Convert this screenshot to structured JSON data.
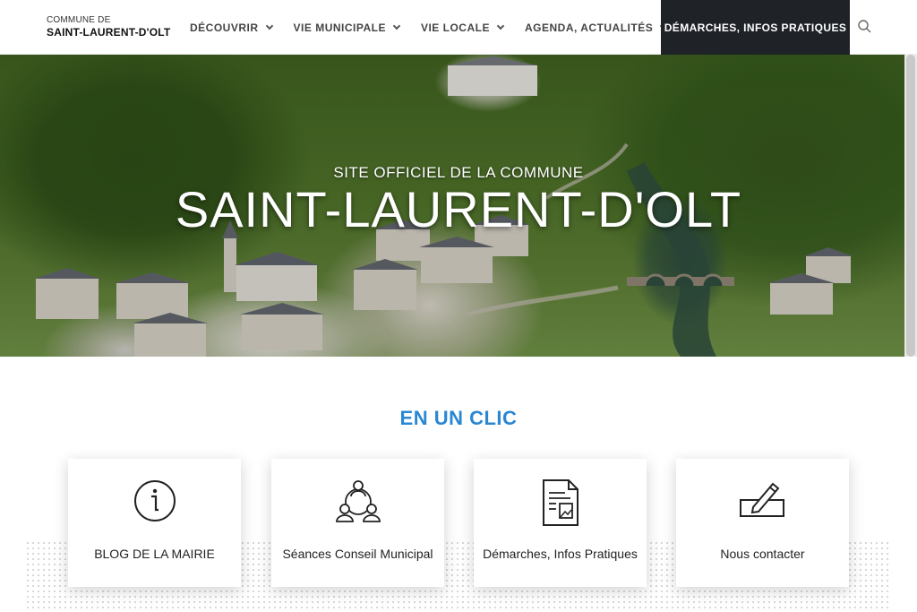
{
  "header": {
    "logo_small": "COMMUNE DE",
    "logo_big": "SAINT-LAURENT-D'OLT",
    "nav": [
      {
        "label": "DÉCOUVRIR"
      },
      {
        "label": "VIE MUNICIPALE"
      },
      {
        "label": "VIE LOCALE"
      },
      {
        "label": "AGENDA, ACTUALITÉS"
      }
    ],
    "cta_label": "DÉMARCHES, INFOS PRATIQUES",
    "search_icon": "search-icon"
  },
  "hero": {
    "subtitle": "SITE OFFICIEL DE LA COMMUNE",
    "title": "SAINT-LAURENT-D'OLT"
  },
  "quick_links": {
    "title": "EN UN CLIC",
    "accent_color": "#2a87d3",
    "cards": [
      {
        "label": "BLOG DE LA MAIRIE",
        "icon": "info-icon"
      },
      {
        "label": "Séances Conseil Municipal",
        "icon": "council-icon"
      },
      {
        "label": "Démarches, Infos Pratiques",
        "icon": "document-icon"
      },
      {
        "label": "Nous contacter",
        "icon": "write-icon"
      }
    ]
  }
}
